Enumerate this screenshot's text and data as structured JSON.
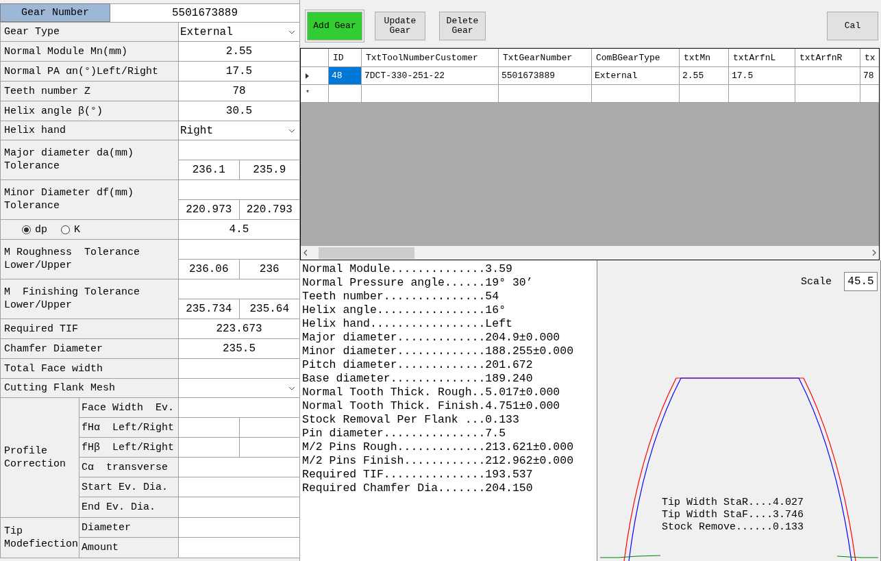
{
  "form": {
    "gear_number": {
      "label": "Gear Number",
      "value": "5501673889"
    },
    "rows": [
      {
        "kind": "select",
        "label": "Gear Type",
        "value": "External"
      },
      {
        "kind": "value",
        "label": "Normal Module Mn(mm)",
        "value": "2.55"
      },
      {
        "kind": "value",
        "label": "Normal PA αn(°)Left/Right",
        "value": "17.5"
      },
      {
        "kind": "value",
        "label": "Teeth number Z",
        "value": "78"
      },
      {
        "kind": "value",
        "label": "Helix angle β(°)",
        "value": "30.5"
      },
      {
        "kind": "select",
        "label": "Helix hand",
        "value": "Right"
      },
      {
        "kind": "pair",
        "label": "Major diameter da(mm)",
        "sublabel": "Tolerance",
        "values": [
          "236.1",
          "235.9"
        ]
      },
      {
        "kind": "pair",
        "label": "Minor Diameter df(mm)",
        "sublabel": "Tolerance",
        "values": [
          "220.973",
          "220.793"
        ]
      },
      {
        "kind": "radio",
        "options": [
          {
            "label": "dp",
            "selected": true
          },
          {
            "label": "K",
            "selected": false
          }
        ],
        "value": "4.5"
      },
      {
        "kind": "pair",
        "label": "M Roughness  Tolerance",
        "sublabel": "Lower/Upper",
        "values": [
          "236.06",
          "236"
        ]
      },
      {
        "kind": "pair",
        "label": "M  Finishing Tolerance",
        "sublabel": "Lower/Upper",
        "values": [
          "235.734",
          "235.64"
        ]
      },
      {
        "kind": "value",
        "label": "Required TIF",
        "value": "223.673"
      },
      {
        "kind": "value",
        "label": "Chamfer Diameter",
        "value": "235.5"
      },
      {
        "kind": "value",
        "label": "Total Face width"
      },
      {
        "kind": "select",
        "label": "Cutting Flank Mesh"
      },
      {
        "kind": "group",
        "label": "Profile Correction",
        "items": [
          {
            "kind": "single",
            "label": "Face Width  Ev."
          },
          {
            "kind": "split",
            "label": "fHα  Left/Right"
          },
          {
            "kind": "split",
            "label": "fHβ  Left/Right"
          },
          {
            "kind": "single",
            "label": "Cα  transverse"
          },
          {
            "kind": "single",
            "label": "Start Ev. Dia."
          },
          {
            "kind": "single",
            "label": "End Ev. Dia."
          }
        ]
      },
      {
        "kind": "group",
        "label": "Tip Modefiection",
        "items": [
          {
            "kind": "single",
            "label": "Diameter"
          },
          {
            "kind": "single",
            "label": "Amount"
          }
        ]
      }
    ]
  },
  "toolbar": {
    "buttons": [
      {
        "label": "Add Gear",
        "active": true
      },
      {
        "label": "Update Gear",
        "active": false
      },
      {
        "label": "Delete Gear",
        "active": false
      }
    ],
    "calc_button": "Cal"
  },
  "grid": {
    "columns": [
      "ID",
      "TxtToolNumberCustomer",
      "TxtGearNumber",
      "ComBGearType",
      "txtMn",
      "txtArfnL",
      "txtArfnR",
      "tx"
    ],
    "rows": [
      {
        "current": true,
        "cells": [
          {
            "text": "48",
            "selected": true
          },
          {
            "text": "7DCT-330-251-22",
            "selected": false
          },
          {
            "text": "5501673889",
            "selected": false
          },
          {
            "text": "External",
            "selected": false
          },
          {
            "text": "2.55",
            "selected": false
          },
          {
            "text": "17.5",
            "selected": false
          },
          {
            "selected": false
          },
          {
            "text": "78",
            "selected": false
          }
        ]
      }
    ],
    "new_row_marker": "*"
  },
  "results": [
    "Normal Module..............3.59",
    "Normal Pressure angle......19° 30’",
    "Teeth number...............54",
    "Helix angle................16°",
    "Helix hand.................Left",
    "Major diameter.............204.9±0.000",
    "Minor diameter.............188.255±0.000",
    "Pitch diameter.............201.672",
    "Base diameter..............189.240",
    "Normal Tooth Thick. Rough..5.017±0.000",
    "Normal Tooth Thick. Finish.4.751±0.000",
    "Stock Removal Per Flank ...0.133",
    "Pin diameter...............7.5",
    "M/2 Pins Rough.............213.621±0.000",
    "M/2 Pins Finish............212.962±0.000",
    "Required TIF...............193.537",
    "Required Chamfer Dia.......204.150"
  ],
  "drawing": {
    "scale_label": "Scale",
    "scale_value": "45.5",
    "notes": [
      "Tip Width StaR....4.027",
      "Tip Width StaF....3.746",
      "Stock Remove......0.133"
    ]
  }
}
